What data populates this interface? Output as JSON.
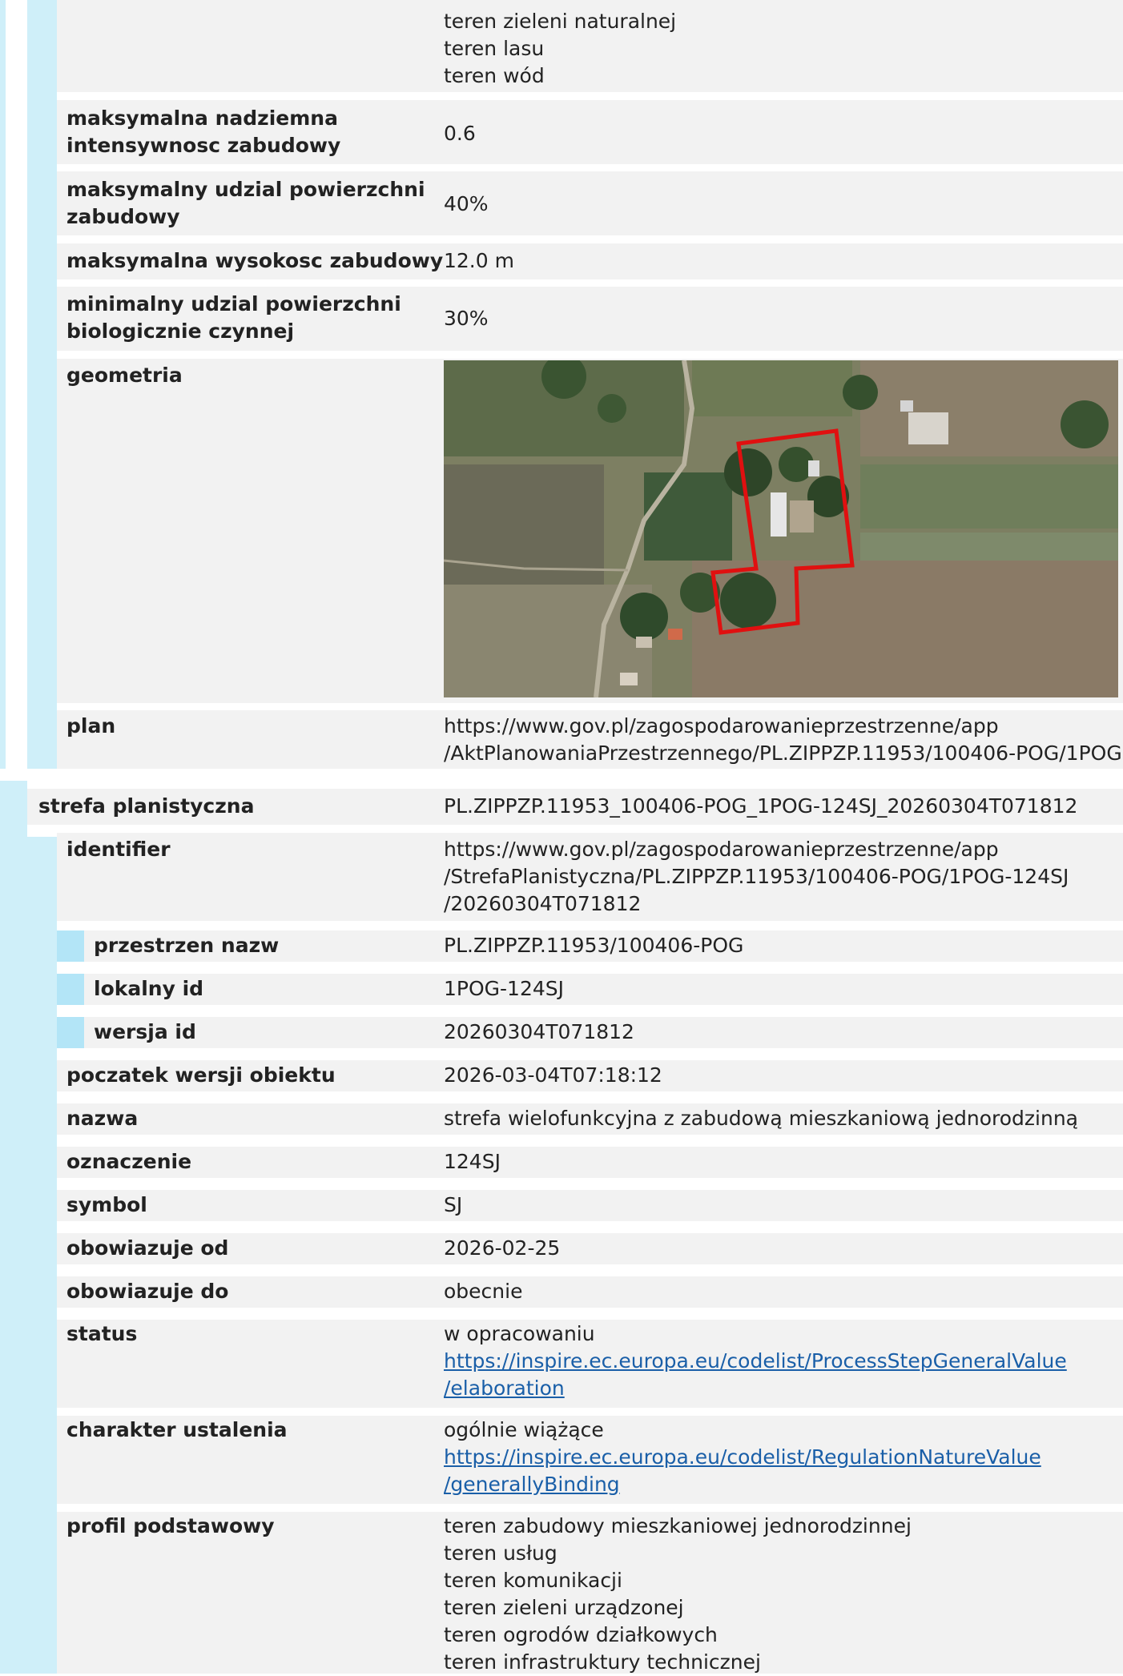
{
  "section1": {
    "land_use_values": [
      "teren zieleni naturalnej",
      "teren lasu",
      "teren wód"
    ],
    "rows": [
      {
        "label": "maksymalna nadziemna intensywnosc zabudowy",
        "label_lines": [
          "maksymalna nadziemna",
          "intensywnosc zabudowy"
        ],
        "value": "0.6"
      },
      {
        "label": "maksymalny udzial powierzchni zabudowy",
        "label_lines": [
          "maksymalny udzial powierzchni",
          "zabudowy"
        ],
        "value": "40%"
      },
      {
        "label": "maksymalna wysokosc zabudowy",
        "label_lines": [
          "maksymalna wysokosc zabudowy"
        ],
        "value": "12.0 m"
      },
      {
        "label": "minimalny udzial powierzchni biologicznie czynnej",
        "label_lines": [
          "minimalny udzial powierzchni",
          "biologicznie czynnej"
        ],
        "value": "30%"
      }
    ],
    "geometry_label": "geometria",
    "plan_label": "plan",
    "plan_value_lines": [
      "https://www.gov.pl/zagospodarowanieprzestrzenne/app",
      "/AktPlanowaniaPrzestrzennego/PL.ZIPPZP.11953/100406-POG/1POG"
    ]
  },
  "section2": {
    "title": "strefa planistyczna",
    "title_value": "PL.ZIPPZP.11953_100406-POG_1POG-124SJ_20260304T071812",
    "identifier_label": "identifier",
    "identifier_value_lines": [
      "https://www.gov.pl/zagospodarowanieprzestrzenne/app",
      "/StrefaPlanistyczna/PL.ZIPPZP.11953/100406-POG/1POG-124SJ",
      "/20260304T071812"
    ],
    "sub_rows": [
      {
        "label": "przestrzen nazw",
        "value": "PL.ZIPPZP.11953/100406-POG"
      },
      {
        "label": "lokalny id",
        "value": "1POG-124SJ"
      },
      {
        "label": "wersja id",
        "value": "20260304T071812"
      }
    ],
    "rows": [
      {
        "label": "poczatek wersji obiektu",
        "value": "2026-03-04T07:18:12"
      },
      {
        "label": "nazwa",
        "value": "strefa wielofunkcyjna z zabudową mieszkaniową jednorodzinną"
      },
      {
        "label": "oznaczenie",
        "value": "124SJ"
      },
      {
        "label": "symbol",
        "value": "SJ"
      },
      {
        "label": "obowiazuje od",
        "value": "2026-02-25"
      },
      {
        "label": "obowiazuje do",
        "value": "obecnie"
      }
    ],
    "status_label": "status",
    "status_text": "w opracowaniu",
    "status_link_lines": [
      "https://inspire.ec.europa.eu/codelist/ProcessStepGeneralValue",
      "/elaboration"
    ],
    "character_label": "charakter ustalenia",
    "character_text": "ogólnie wiążące",
    "character_link_lines": [
      "https://inspire.ec.europa.eu/codelist/RegulationNatureValue",
      "/generallyBinding"
    ],
    "profile_label": "profil podstawowy",
    "profile_values": [
      "teren zabudowy mieszkaniowej jednorodzinnej",
      "teren usług",
      "teren komunikacji",
      "teren zieleni urządzonej",
      "teren ogrodów działkowych",
      "teren infrastruktury technicznej"
    ]
  },
  "colors": {
    "outer_bar": "#cfeff9",
    "inner_bar": "#b3e5f7",
    "stripe": "#f2f2f2",
    "link": "#1a5fa8",
    "boundary": "#e01010"
  }
}
